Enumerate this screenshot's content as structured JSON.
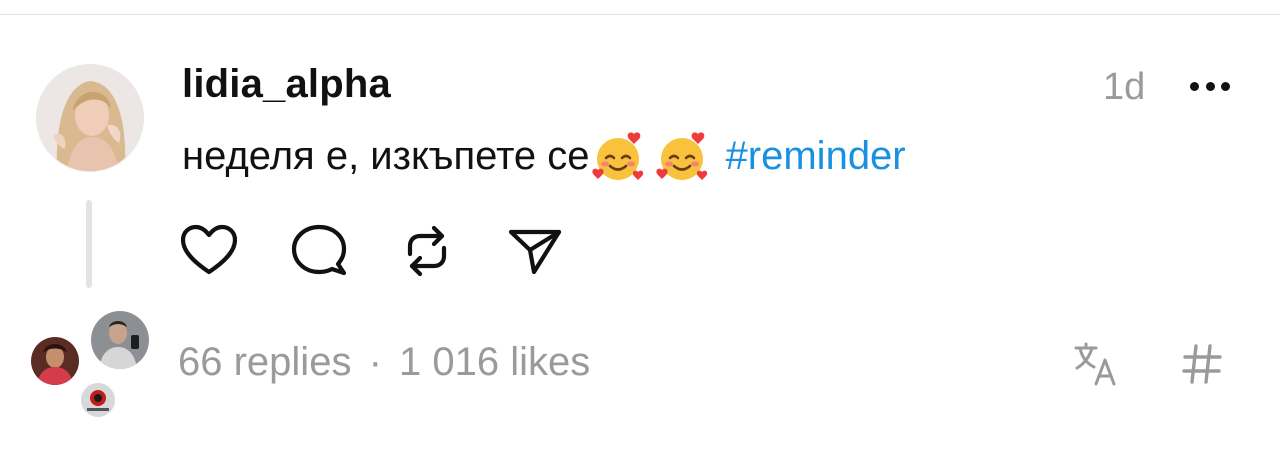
{
  "post": {
    "username": "lidia_alpha",
    "timestamp": "1d",
    "text": "неделя е, изкъпете се",
    "emojis": [
      "smiling-face-with-hearts",
      "smiling-face-with-hearts"
    ],
    "hashtag": "#reminder"
  },
  "actions": {
    "icons": [
      "heart-icon",
      "comment-icon",
      "repost-icon",
      "share-icon"
    ]
  },
  "footer": {
    "replies": "66 replies",
    "separator": "·",
    "likes": "1 016 likes",
    "icons": [
      "translate-icon",
      "hashtag-icon"
    ]
  },
  "colors": {
    "hashtag": "#1a90e0",
    "muted": "#9a9a9a",
    "text": "#111111",
    "divider": "#e2e2e2"
  }
}
